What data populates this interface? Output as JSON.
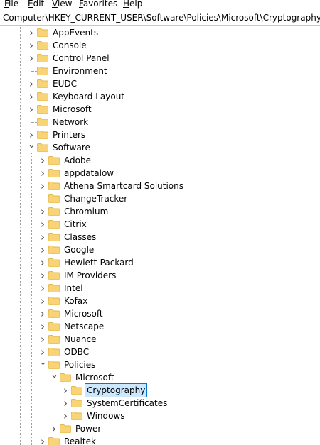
{
  "menu": [
    {
      "label": "File",
      "mnemonic": "F",
      "rest": "ile"
    },
    {
      "label": "Edit",
      "mnemonic": "E",
      "rest": "dit"
    },
    {
      "label": "View",
      "mnemonic": "V",
      "rest": "iew"
    },
    {
      "label": "Favorites",
      "mnemonic": "F",
      "rest": "avorites"
    },
    {
      "label": "Help",
      "mnemonic": "H",
      "rest": "elp"
    }
  ],
  "address": "Computer\\HKEY_CURRENT_USER\\Software\\Policies\\Microsoft\\Cryptography",
  "colors": {
    "folder": "#f8d476",
    "folder_dark": "#e5b94b",
    "selection_bg": "#cce8ff",
    "selection_border": "#0078d7"
  },
  "tree": [
    {
      "label": "AppEvents",
      "depth": 0,
      "state": "collapsed"
    },
    {
      "label": "Console",
      "depth": 0,
      "state": "collapsed"
    },
    {
      "label": "Control Panel",
      "depth": 0,
      "state": "collapsed"
    },
    {
      "label": "Environment",
      "depth": 0,
      "state": "leaf"
    },
    {
      "label": "EUDC",
      "depth": 0,
      "state": "collapsed"
    },
    {
      "label": "Keyboard Layout",
      "depth": 0,
      "state": "collapsed"
    },
    {
      "label": "Microsoft",
      "depth": 0,
      "state": "collapsed"
    },
    {
      "label": "Network",
      "depth": 0,
      "state": "leaf"
    },
    {
      "label": "Printers",
      "depth": 0,
      "state": "collapsed"
    },
    {
      "label": "Software",
      "depth": 0,
      "state": "expanded"
    },
    {
      "label": "Adobe",
      "depth": 1,
      "state": "collapsed"
    },
    {
      "label": "appdatalow",
      "depth": 1,
      "state": "collapsed"
    },
    {
      "label": "Athena Smartcard Solutions",
      "depth": 1,
      "state": "collapsed"
    },
    {
      "label": "ChangeTracker",
      "depth": 1,
      "state": "leaf"
    },
    {
      "label": "Chromium",
      "depth": 1,
      "state": "collapsed"
    },
    {
      "label": "Citrix",
      "depth": 1,
      "state": "collapsed"
    },
    {
      "label": "Classes",
      "depth": 1,
      "state": "collapsed"
    },
    {
      "label": "Google",
      "depth": 1,
      "state": "collapsed"
    },
    {
      "label": "Hewlett-Packard",
      "depth": 1,
      "state": "collapsed"
    },
    {
      "label": "IM Providers",
      "depth": 1,
      "state": "collapsed"
    },
    {
      "label": "Intel",
      "depth": 1,
      "state": "collapsed"
    },
    {
      "label": "Kofax",
      "depth": 1,
      "state": "collapsed"
    },
    {
      "label": "Microsoft",
      "depth": 1,
      "state": "collapsed"
    },
    {
      "label": "Netscape",
      "depth": 1,
      "state": "collapsed"
    },
    {
      "label": "Nuance",
      "depth": 1,
      "state": "collapsed"
    },
    {
      "label": "ODBC",
      "depth": 1,
      "state": "collapsed"
    },
    {
      "label": "Policies",
      "depth": 1,
      "state": "expanded"
    },
    {
      "label": "Microsoft",
      "depth": 2,
      "state": "expanded"
    },
    {
      "label": "Cryptography",
      "depth": 3,
      "state": "collapsed",
      "selected": true
    },
    {
      "label": "SystemCertificates",
      "depth": 3,
      "state": "collapsed"
    },
    {
      "label": "Windows",
      "depth": 3,
      "state": "collapsed"
    },
    {
      "label": "Power",
      "depth": 2,
      "state": "collapsed"
    },
    {
      "label": "Realtek",
      "depth": 1,
      "state": "collapsed"
    }
  ]
}
